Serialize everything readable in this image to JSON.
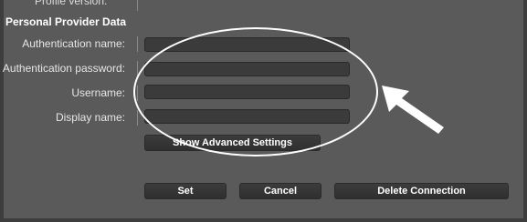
{
  "header": {
    "profile_version_label": "Profile version:"
  },
  "section": {
    "title": "Personal Provider Data"
  },
  "fields": [
    {
      "label": "Authentication name:",
      "value": ""
    },
    {
      "label": "Authentication password:",
      "value": ""
    },
    {
      "label": "Username:",
      "value": ""
    },
    {
      "label": "Display name:",
      "value": ""
    }
  ],
  "buttons": {
    "advanced": "Show Advanced Settings",
    "set": "Set",
    "cancel": "Cancel",
    "delete": "Delete Connection"
  },
  "annotation": {
    "color": "#ffffff",
    "shapes": [
      "ellipse",
      "arrow-icon"
    ]
  }
}
